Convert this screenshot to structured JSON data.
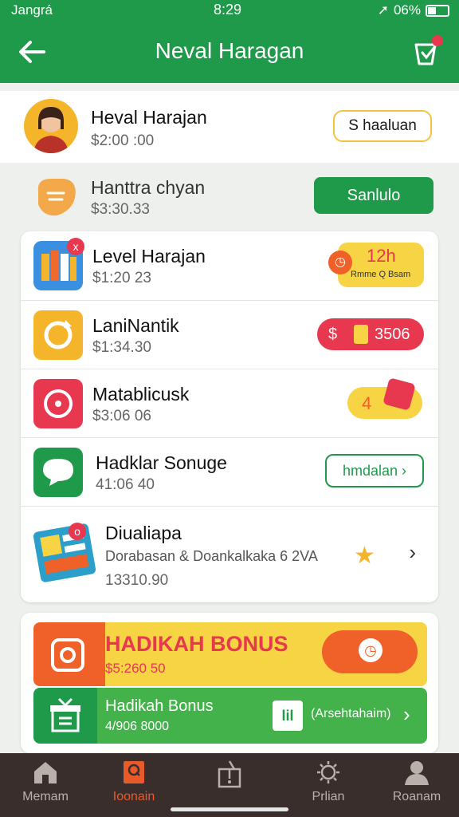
{
  "status_bar": {
    "carrier": "Jangrá",
    "time": "8:29",
    "battery": "06%"
  },
  "app_bar": {
    "title": "Neval Haragan"
  },
  "profile": {
    "name": "Heval Harajan",
    "amount": "$2:00 :00",
    "button": "S haaluan"
  },
  "secondary": {
    "name": "Hanttra chyan",
    "amount": "$3:30.33",
    "button": "Sanlulo"
  },
  "list": [
    {
      "title": "Level Harajan",
      "sub": "$1:20 23",
      "badge": "x",
      "chip": "12h",
      "chip_sub": "Rmme Q Bsam"
    },
    {
      "title": "LaniNantik",
      "sub": "$1:34.30",
      "chip_left": "$",
      "chip_right": "3506"
    },
    {
      "title": "Matablicusk",
      "sub": "$3:06 06",
      "chip": "4"
    },
    {
      "title": "Hadklar Sonuge",
      "sub": "41:06 40",
      "button": "hmdalan"
    },
    {
      "title": "Diualiapa",
      "desc": "Dorabasan & Doankalkaka 6 2VA",
      "sub": "13310.90",
      "badge": "o"
    }
  ],
  "bonus": {
    "title": "HADIKAH BONUS",
    "amount": "$5:260 50",
    "sub_title": "Hadikah Bonus",
    "sub_amount": "4/906 8000",
    "sub_button": "(Arsehtahaim)",
    "sub_button_icon": "lil"
  },
  "nav": [
    {
      "label": "Memam",
      "icon": "home-icon"
    },
    {
      "label": "Ioonain",
      "icon": "wallet-icon",
      "active": true
    },
    {
      "label": "",
      "icon": "gift-icon"
    },
    {
      "label": "Prlian",
      "icon": "sun-icon"
    },
    {
      "label": "Roanam",
      "icon": "person-icon"
    }
  ],
  "colors": {
    "primary": "#1f9a4a",
    "accent": "#f0612a",
    "yellow": "#f6d444",
    "red": "#e8384f",
    "nav_bg": "#3a2e2c"
  }
}
